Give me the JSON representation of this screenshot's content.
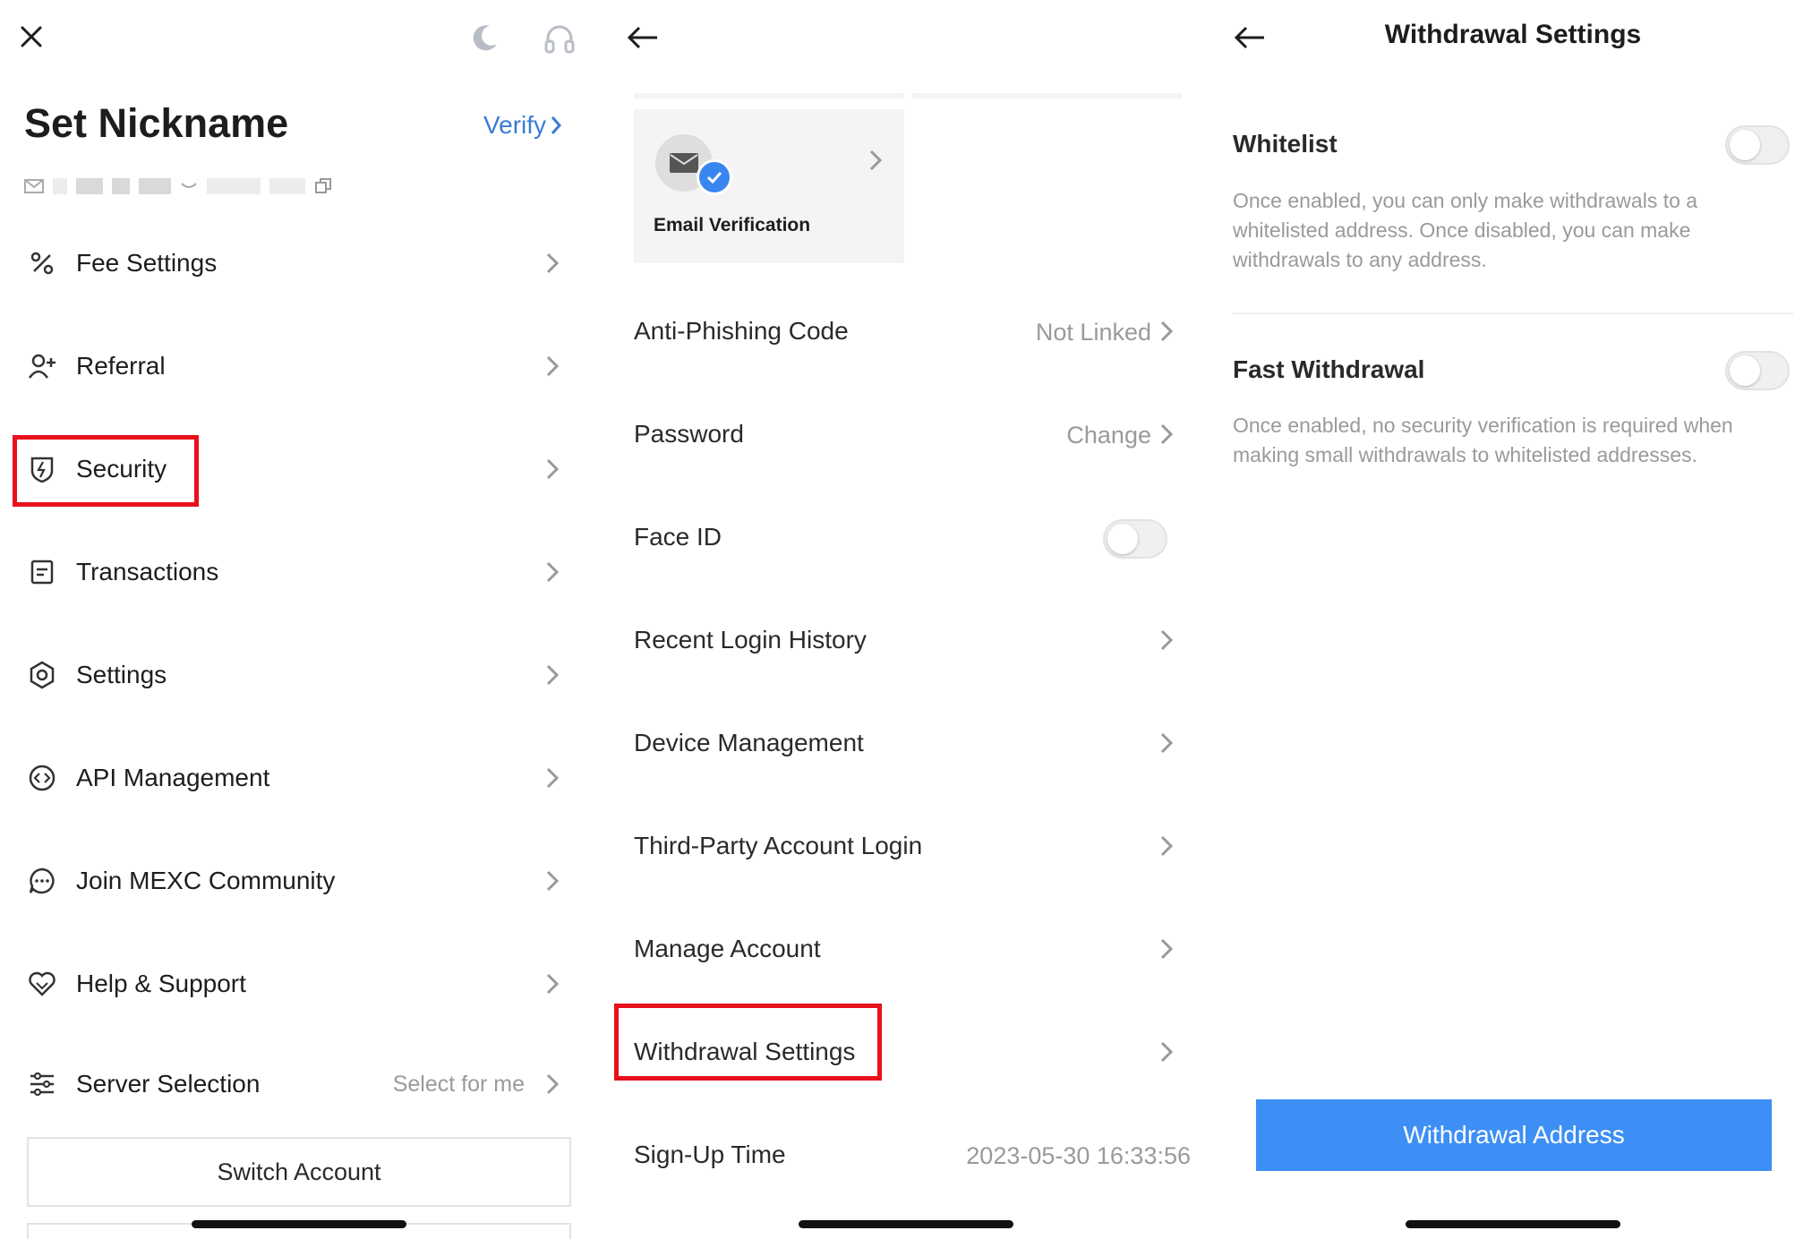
{
  "colors": {
    "accent": "#3a7bd5",
    "primary_button": "#3d8ff5",
    "highlight_box": "#e8101a",
    "muted_text": "#9a9a9a"
  },
  "panel1": {
    "close_icon": "close-icon",
    "moon_icon": "moon-icon",
    "headset_icon": "headset-icon",
    "title": "Set Nickname",
    "verify_label": "Verify",
    "menu": [
      {
        "label": "Fee Settings",
        "icon": "percent-icon"
      },
      {
        "label": "Referral",
        "icon": "add-user-icon"
      },
      {
        "label": "Security",
        "icon": "shield-icon"
      },
      {
        "label": "Transactions",
        "icon": "document-icon"
      },
      {
        "label": "Settings",
        "icon": "gear-icon"
      },
      {
        "label": "API Management",
        "icon": "api-icon"
      },
      {
        "label": "Join MEXC Community",
        "icon": "chat-icon"
      },
      {
        "label": "Help & Support",
        "icon": "heart-icon"
      },
      {
        "label": "Server Selection",
        "icon": "sliders-icon",
        "value": "Select for me"
      }
    ],
    "switch_account_label": "Switch Account"
  },
  "panel2": {
    "email_card_label": "Email Verification",
    "rows": [
      {
        "label": "Anti-Phishing Code",
        "value": "Not Linked"
      },
      {
        "label": "Password",
        "value": "Change"
      },
      {
        "label": "Face ID",
        "toggle": false
      },
      {
        "label": "Recent Login History"
      },
      {
        "label": "Device Management"
      },
      {
        "label": "Third-Party Account Login"
      },
      {
        "label": "Manage Account"
      },
      {
        "label": "Withdrawal Settings"
      },
      {
        "label": "Sign-Up Time",
        "value": "2023-05-30 16:33:56"
      }
    ]
  },
  "panel3": {
    "title": "Withdrawal Settings",
    "whitelist_title": "Whitelist",
    "whitelist_desc": "Once enabled, you can only make withdrawals to a whitelisted address. Once disabled, you can make withdrawals to any address.",
    "whitelist_enabled": false,
    "fast_title": "Fast Withdrawal",
    "fast_desc": "Once enabled, no security verification is required when making small withdrawals to whitelisted addresses.",
    "fast_enabled": false,
    "button_label": "Withdrawal Address"
  }
}
